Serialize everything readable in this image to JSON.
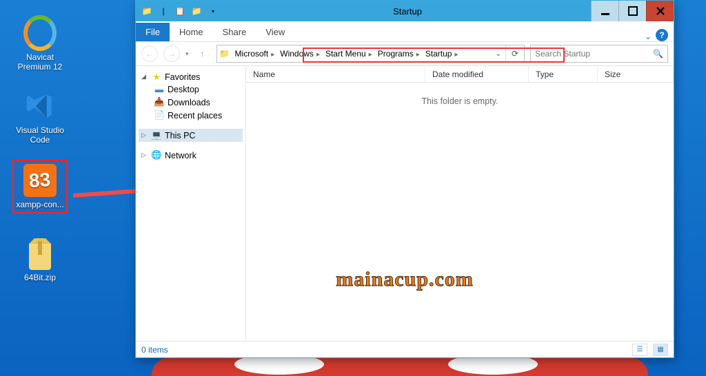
{
  "desktop": {
    "icons": [
      {
        "label": "Navicat Premium 12"
      },
      {
        "label": "Visual Studio Code"
      },
      {
        "label": "xampp-con..."
      },
      {
        "label": "64Bit.zip"
      }
    ]
  },
  "window": {
    "title": "Startup",
    "ribbon_tabs": {
      "file": "File",
      "home": "Home",
      "share": "Share",
      "view": "View"
    },
    "breadcrumbs": [
      "Microsoft",
      "Windows",
      "Start Menu",
      "Programs",
      "Startup"
    ],
    "search_placeholder": "Search Startup",
    "columns": {
      "name": "Name",
      "date": "Date modified",
      "type": "Type",
      "size": "Size"
    },
    "empty_text": "This folder is empty.",
    "status_items": "0 items",
    "navpane": {
      "favorites": {
        "label": "Favorites",
        "items": [
          "Desktop",
          "Downloads",
          "Recent places"
        ]
      },
      "thispc": {
        "label": "This PC"
      },
      "network": {
        "label": "Network"
      }
    }
  },
  "watermark": "mainacup.com"
}
